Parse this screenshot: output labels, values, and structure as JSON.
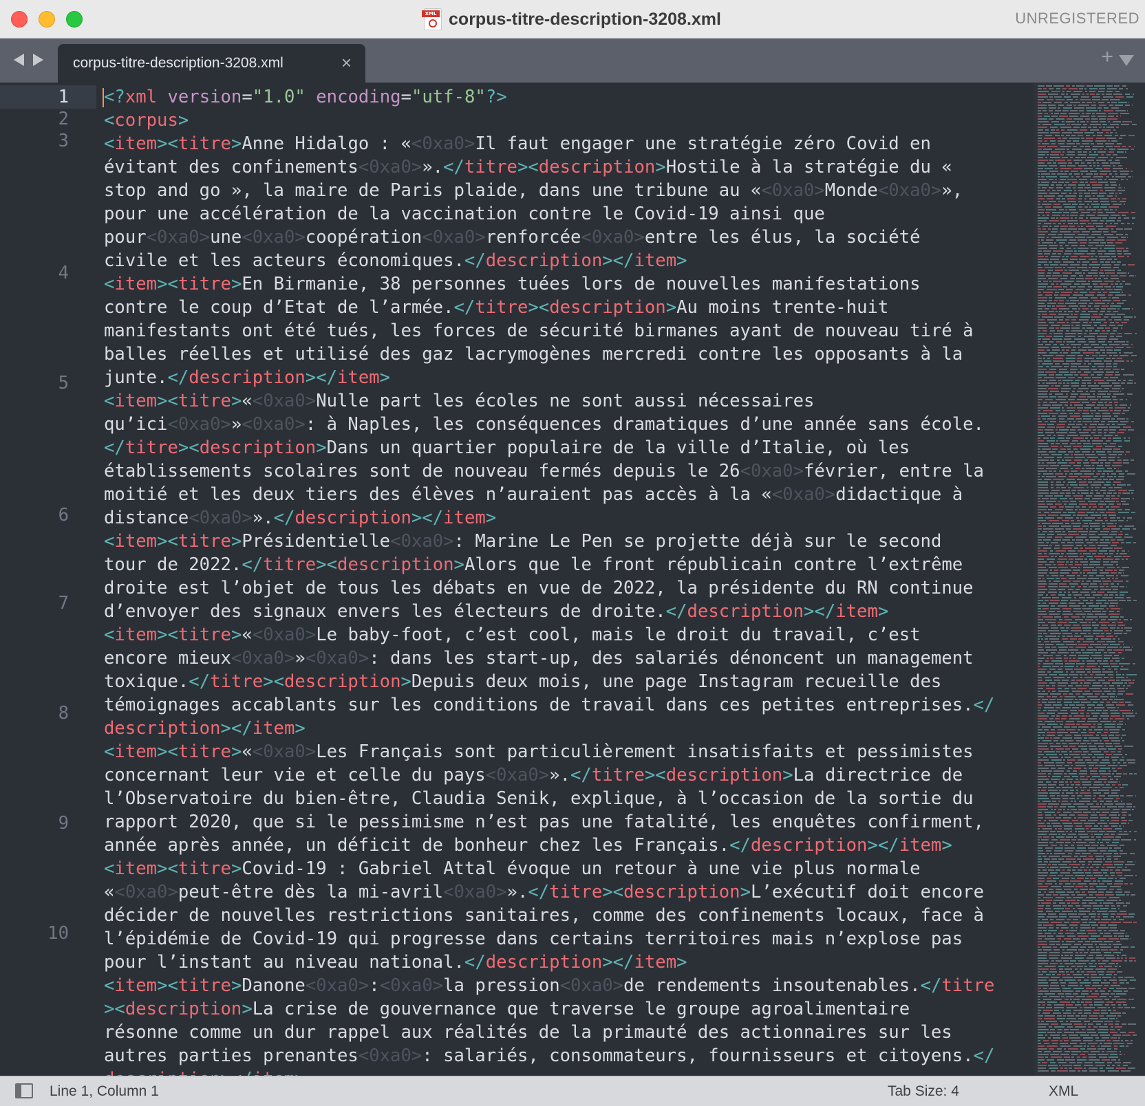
{
  "window": {
    "title": "corpus-titre-description-3208.xml",
    "license_label": "UNREGISTERED",
    "file_icon_tag": "XML"
  },
  "tabs": [
    {
      "label": "corpus-titre-description-3208.xml",
      "close_glyph": "×",
      "active": true
    }
  ],
  "tabbar": {
    "new_tab_glyph": "+"
  },
  "editor": {
    "line_numbers": [
      "1",
      "2",
      "3",
      "4",
      "5",
      "6",
      "7",
      "8",
      "9",
      "10"
    ],
    "active_line": "1",
    "colors": {
      "background": "#2b3037",
      "tag": "#ef6b73",
      "punctuation": "#5fb4b4",
      "attribute": "#c695c6",
      "string": "#99c794",
      "control_char": "#4d545e",
      "caret": "#f99157"
    },
    "visual_lines": [
      [
        [
          "p",
          "<?"
        ],
        [
          "t",
          "xml"
        ],
        [
          "x",
          " "
        ],
        [
          "a",
          "version"
        ],
        [
          "x",
          "="
        ],
        [
          "s",
          "\"1.0\""
        ],
        [
          "x",
          " "
        ],
        [
          "a",
          "encoding"
        ],
        [
          "x",
          "="
        ],
        [
          "s",
          "\"utf-8\""
        ],
        [
          "p",
          "?>"
        ]
      ],
      [
        [
          "p",
          "<"
        ],
        [
          "t",
          "corpus"
        ],
        [
          "p",
          ">"
        ]
      ],
      [
        [
          "p",
          "<"
        ],
        [
          "t",
          "item"
        ],
        [
          "p",
          "><"
        ],
        [
          "t",
          "titre"
        ],
        [
          "p",
          ">"
        ],
        [
          "x",
          "Anne Hidalgo : «"
        ],
        [
          "cp",
          "<0xa0>"
        ],
        [
          "x",
          "Il faut engager une stratégie zéro Covid en"
        ]
      ],
      [
        [
          "x",
          "évitant des confinements"
        ],
        [
          "cp",
          "<0xa0>"
        ],
        [
          "x",
          "»."
        ],
        [
          "p",
          "</"
        ],
        [
          "t",
          "titre"
        ],
        [
          "p",
          "><"
        ],
        [
          "t",
          "description"
        ],
        [
          "p",
          ">"
        ],
        [
          "x",
          "Hostile à la stratégie du «"
        ]
      ],
      [
        [
          "x",
          "stop and go », la maire de Paris plaide, dans une tribune au «"
        ],
        [
          "cp",
          "<0xa0>"
        ],
        [
          "x",
          "Monde"
        ],
        [
          "cp",
          "<0xa0>"
        ],
        [
          "x",
          "»,"
        ]
      ],
      [
        [
          "x",
          "pour une accélération de la vaccination contre le Covid-19 ainsi que"
        ]
      ],
      [
        [
          "x",
          "pour"
        ],
        [
          "cp",
          "<0xa0>"
        ],
        [
          "x",
          "une"
        ],
        [
          "cp",
          "<0xa0>"
        ],
        [
          "x",
          "coopération"
        ],
        [
          "cp",
          "<0xa0>"
        ],
        [
          "x",
          "renforcée"
        ],
        [
          "cp",
          "<0xa0>"
        ],
        [
          "x",
          "entre les élus, la société"
        ]
      ],
      [
        [
          "x",
          "civile et les acteurs économiques."
        ],
        [
          "p",
          "</"
        ],
        [
          "t",
          "description"
        ],
        [
          "p",
          "></"
        ],
        [
          "t",
          "item"
        ],
        [
          "p",
          ">"
        ]
      ],
      [
        [
          "p",
          "<"
        ],
        [
          "t",
          "item"
        ],
        [
          "p",
          "><"
        ],
        [
          "t",
          "titre"
        ],
        [
          "p",
          ">"
        ],
        [
          "x",
          "En Birmanie, 38 personnes tuées lors de nouvelles manifestations"
        ]
      ],
      [
        [
          "x",
          "contre le coup d’Etat de l’armée."
        ],
        [
          "p",
          "</"
        ],
        [
          "t",
          "titre"
        ],
        [
          "p",
          "><"
        ],
        [
          "t",
          "description"
        ],
        [
          "p",
          ">"
        ],
        [
          "x",
          "Au moins trente-huit"
        ]
      ],
      [
        [
          "x",
          "manifestants ont été tués, les forces de sécurité birmanes ayant de nouveau tiré à"
        ]
      ],
      [
        [
          "x",
          "balles réelles et utilisé des gaz lacrymogènes mercredi contre les opposants à la"
        ]
      ],
      [
        [
          "x",
          "junte."
        ],
        [
          "p",
          "</"
        ],
        [
          "t",
          "description"
        ],
        [
          "p",
          "></"
        ],
        [
          "t",
          "item"
        ],
        [
          "p",
          ">"
        ]
      ],
      [
        [
          "p",
          "<"
        ],
        [
          "t",
          "item"
        ],
        [
          "p",
          "><"
        ],
        [
          "t",
          "titre"
        ],
        [
          "p",
          ">"
        ],
        [
          "x",
          "«"
        ],
        [
          "cp",
          "<0xa0>"
        ],
        [
          "x",
          "Nulle part les écoles ne sont aussi nécessaires"
        ]
      ],
      [
        [
          "x",
          "qu’ici"
        ],
        [
          "cp",
          "<0xa0>"
        ],
        [
          "x",
          "»"
        ],
        [
          "cp",
          "<0xa0>"
        ],
        [
          "x",
          ": à Naples, les conséquences dramatiques d’une année sans école."
        ]
      ],
      [
        [
          "p",
          "</"
        ],
        [
          "t",
          "titre"
        ],
        [
          "p",
          "><"
        ],
        [
          "t",
          "description"
        ],
        [
          "p",
          ">"
        ],
        [
          "x",
          "Dans un quartier populaire de la ville d’Italie, où les"
        ]
      ],
      [
        [
          "x",
          "établissements scolaires sont de nouveau fermés depuis le 26"
        ],
        [
          "cp",
          "<0xa0>"
        ],
        [
          "x",
          "février, entre la"
        ]
      ],
      [
        [
          "x",
          "moitié et les deux tiers des élèves n’auraient pas accès à la «"
        ],
        [
          "cp",
          "<0xa0>"
        ],
        [
          "x",
          "didactique à"
        ]
      ],
      [
        [
          "x",
          "distance"
        ],
        [
          "cp",
          "<0xa0>"
        ],
        [
          "x",
          "»."
        ],
        [
          "p",
          "</"
        ],
        [
          "t",
          "description"
        ],
        [
          "p",
          "></"
        ],
        [
          "t",
          "item"
        ],
        [
          "p",
          ">"
        ]
      ],
      [
        [
          "p",
          "<"
        ],
        [
          "t",
          "item"
        ],
        [
          "p",
          "><"
        ],
        [
          "t",
          "titre"
        ],
        [
          "p",
          ">"
        ],
        [
          "x",
          "Présidentielle"
        ],
        [
          "cp",
          "<0xa0>"
        ],
        [
          "x",
          ": Marine Le Pen se projette déjà sur le second"
        ]
      ],
      [
        [
          "x",
          "tour de 2022."
        ],
        [
          "p",
          "</"
        ],
        [
          "t",
          "titre"
        ],
        [
          "p",
          "><"
        ],
        [
          "t",
          "description"
        ],
        [
          "p",
          ">"
        ],
        [
          "x",
          "Alors que le front républicain contre l’extrême"
        ]
      ],
      [
        [
          "x",
          "droite est l’objet de tous les débats en vue de 2022, la présidente du RN continue"
        ]
      ],
      [
        [
          "x",
          "d’envoyer des signaux envers les électeurs de droite."
        ],
        [
          "p",
          "</"
        ],
        [
          "t",
          "description"
        ],
        [
          "p",
          "></"
        ],
        [
          "t",
          "item"
        ],
        [
          "p",
          ">"
        ]
      ],
      [
        [
          "p",
          "<"
        ],
        [
          "t",
          "item"
        ],
        [
          "p",
          "><"
        ],
        [
          "t",
          "titre"
        ],
        [
          "p",
          ">"
        ],
        [
          "x",
          "«"
        ],
        [
          "cp",
          "<0xa0>"
        ],
        [
          "x",
          "Le baby-foot, c’est cool, mais le droit du travail, c’est"
        ]
      ],
      [
        [
          "x",
          "encore mieux"
        ],
        [
          "cp",
          "<0xa0>"
        ],
        [
          "x",
          "»"
        ],
        [
          "cp",
          "<0xa0>"
        ],
        [
          "x",
          ": dans les start-up, des salariés dénoncent un management"
        ]
      ],
      [
        [
          "x",
          "toxique."
        ],
        [
          "p",
          "</"
        ],
        [
          "t",
          "titre"
        ],
        [
          "p",
          "><"
        ],
        [
          "t",
          "description"
        ],
        [
          "p",
          ">"
        ],
        [
          "x",
          "Depuis deux mois, une page Instagram recueille des"
        ]
      ],
      [
        [
          "x",
          "témoignages accablants sur les conditions de travail dans ces petites entreprises."
        ],
        [
          "p",
          "</"
        ]
      ],
      [
        [
          "t",
          "description"
        ],
        [
          "p",
          "></"
        ],
        [
          "t",
          "item"
        ],
        [
          "p",
          ">"
        ]
      ],
      [
        [
          "p",
          "<"
        ],
        [
          "t",
          "item"
        ],
        [
          "p",
          "><"
        ],
        [
          "t",
          "titre"
        ],
        [
          "p",
          ">"
        ],
        [
          "x",
          "«"
        ],
        [
          "cp",
          "<0xa0>"
        ],
        [
          "x",
          "Les Français sont particulièrement insatisfaits et pessimistes"
        ]
      ],
      [
        [
          "x",
          "concernant leur vie et celle du pays"
        ],
        [
          "cp",
          "<0xa0>"
        ],
        [
          "x",
          "»."
        ],
        [
          "p",
          "</"
        ],
        [
          "t",
          "titre"
        ],
        [
          "p",
          "><"
        ],
        [
          "t",
          "description"
        ],
        [
          "p",
          ">"
        ],
        [
          "x",
          "La directrice de"
        ]
      ],
      [
        [
          "x",
          "l’Observatoire du bien-être, Claudia Senik, explique, à l’occasion de la sortie du"
        ]
      ],
      [
        [
          "x",
          "rapport 2020, que si le pessimisme n’est pas une fatalité, les enquêtes confirment,"
        ]
      ],
      [
        [
          "x",
          "année après année, un déficit de bonheur chez les Français."
        ],
        [
          "p",
          "</"
        ],
        [
          "t",
          "description"
        ],
        [
          "p",
          "></"
        ],
        [
          "t",
          "item"
        ],
        [
          "p",
          ">"
        ]
      ],
      [
        [
          "p",
          "<"
        ],
        [
          "t",
          "item"
        ],
        [
          "p",
          "><"
        ],
        [
          "t",
          "titre"
        ],
        [
          "p",
          ">"
        ],
        [
          "x",
          "Covid-19 : Gabriel Attal évoque un retour à une vie plus normale"
        ]
      ],
      [
        [
          "x",
          "«"
        ],
        [
          "cp",
          "<0xa0>"
        ],
        [
          "x",
          "peut-être dès la mi-avril"
        ],
        [
          "cp",
          "<0xa0>"
        ],
        [
          "x",
          "»."
        ],
        [
          "p",
          "</"
        ],
        [
          "t",
          "titre"
        ],
        [
          "p",
          "><"
        ],
        [
          "t",
          "description"
        ],
        [
          "p",
          ">"
        ],
        [
          "x",
          "L’exécutif doit encore"
        ]
      ],
      [
        [
          "x",
          "décider de nouvelles restrictions sanitaires, comme des confinements locaux, face à"
        ]
      ],
      [
        [
          "x",
          "l’épidémie de Covid-19 qui progresse dans certains territoires mais n’explose pas"
        ]
      ],
      [
        [
          "x",
          "pour l’instant au niveau national."
        ],
        [
          "p",
          "</"
        ],
        [
          "t",
          "description"
        ],
        [
          "p",
          "></"
        ],
        [
          "t",
          "item"
        ],
        [
          "p",
          ">"
        ]
      ],
      [
        [
          "p",
          "<"
        ],
        [
          "t",
          "item"
        ],
        [
          "p",
          "><"
        ],
        [
          "t",
          "titre"
        ],
        [
          "p",
          ">"
        ],
        [
          "x",
          "Danone"
        ],
        [
          "cp",
          "<0xa0>"
        ],
        [
          "x",
          ":"
        ],
        [
          "cp",
          "<0xa0>"
        ],
        [
          "x",
          "la pression"
        ],
        [
          "cp",
          "<0xa0>"
        ],
        [
          "x",
          "de rendements insoutenables."
        ],
        [
          "p",
          "</"
        ],
        [
          "t",
          "titre"
        ]
      ],
      [
        [
          "p",
          ">"
        ],
        [
          "p",
          "<"
        ],
        [
          "t",
          "description"
        ],
        [
          "p",
          ">"
        ],
        [
          "x",
          "La crise de gouvernance que traverse le groupe agroalimentaire"
        ]
      ],
      [
        [
          "x",
          "résonne comme un dur rappel aux réalités de la primauté des actionnaires sur les"
        ]
      ],
      [
        [
          "x",
          "autres parties prenantes"
        ],
        [
          "cp",
          "<0xa0>"
        ],
        [
          "x",
          ": salariés, consommateurs, fournisseurs et citoyens."
        ],
        [
          "p",
          "</"
        ]
      ],
      [
        [
          "t",
          "description"
        ],
        [
          "p",
          "></"
        ],
        [
          "t",
          "item"
        ],
        [
          "p",
          ">"
        ]
      ]
    ]
  },
  "statusbar": {
    "position": "Line 1, Column 1",
    "tab_size": "Tab Size: 4",
    "syntax": "XML"
  }
}
